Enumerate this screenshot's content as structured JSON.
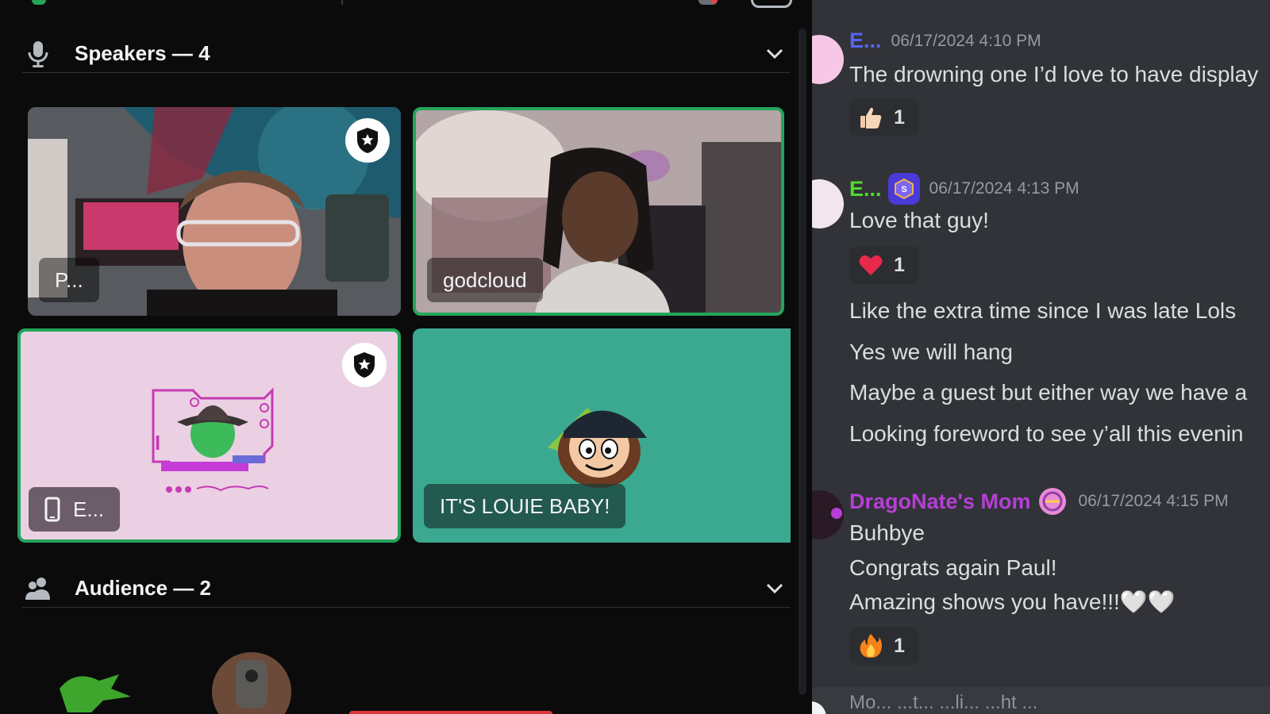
{
  "stage": {
    "speakers": {
      "title": "Speakers — 4",
      "icon": "microphone-icon"
    },
    "audience": {
      "title": "Audience — 2",
      "icon": "audience-icon"
    },
    "tiles": [
      {
        "name": "P...",
        "speaking": false,
        "moderator": true
      },
      {
        "name": "godcloud",
        "speaking": true,
        "moderator": false
      },
      {
        "name": "E...",
        "speaking": true,
        "moderator": true,
        "device": "mobile-icon"
      },
      {
        "name": "IT'S LOUIE BABY!",
        "speaking": false,
        "moderator": false
      }
    ]
  },
  "chat": {
    "messages": [
      {
        "author": "E...",
        "author_color": "#5865f2",
        "timestamp": "06/17/2024 4:10 PM",
        "lines": [
          "The drowning one I’d love to have display"
        ],
        "reaction": {
          "emoji": "thumbs-up-icon",
          "count": "1"
        }
      },
      {
        "author": "E...",
        "author_color": "#4fdc2b",
        "timestamp": "06/17/2024 4:13 PM",
        "lines": [
          "Love that guy!",
          "Like the extra time since I was late Lols",
          "Yes we will hang",
          "Maybe a guest but either way we have a",
          "Looking foreword to see y’all this evenin"
        ],
        "reaction": {
          "emoji": "heart-icon",
          "count": "1"
        }
      },
      {
        "author": "DragoNate's Mom",
        "author_color": "#b63fd6",
        "timestamp": "06/17/2024 4:15 PM",
        "lines": [
          "Buhbye",
          "Congrats again Paul!",
          "Amazing shows you have!!!🤍🤍"
        ],
        "reaction": {
          "emoji": "fire-icon",
          "count": "1"
        }
      }
    ],
    "composer_partial": "Mo... ...t... ...li... ...ht ..."
  }
}
